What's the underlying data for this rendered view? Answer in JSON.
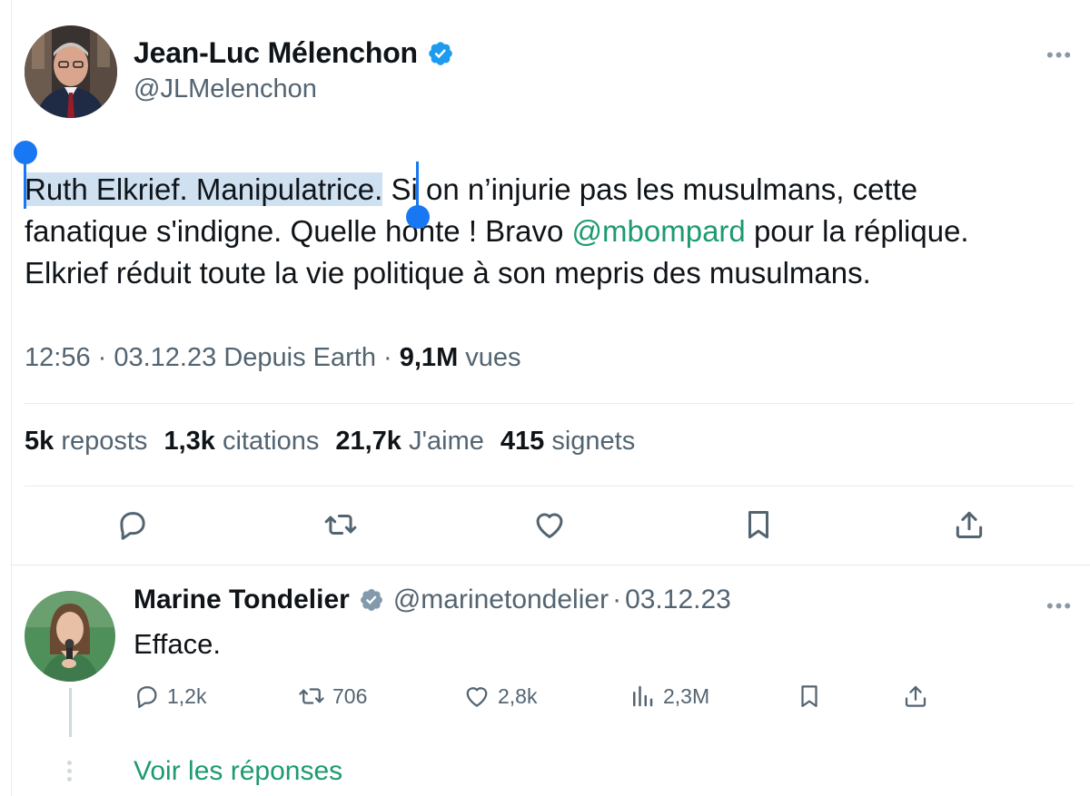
{
  "main_tweet": {
    "author_name": "Jean-Luc Mélenchon",
    "author_handle": "@JLMelenchon",
    "text_line1_selected": "Ruth Elkrief. Manipulatrice.",
    "text_line1_rest": " Si on n’injurie pas les musulmans, cette",
    "text_line2_before_mention": "fanatique s'indigne. Quelle honte ! Bravo ",
    "text_line2_mention": "@mbompard",
    "text_line2_after_mention": " pour la réplique.",
    "text_line3": "Elkrief réduit toute la vie politique à son mepris des musulmans.",
    "time": "12:56",
    "date": "03.12.23",
    "source": "Depuis Earth",
    "views_count": "9,1M",
    "views_label": "vues",
    "stats": [
      {
        "count": "5k",
        "label": "reposts"
      },
      {
        "count": "1,3k",
        "label": "citations"
      },
      {
        "count": "21,7k",
        "label": "J'aime"
      },
      {
        "count": "415",
        "label": "signets"
      }
    ],
    "actions": [
      "reply-icon",
      "repost-icon",
      "like-icon",
      "bookmark-icon",
      "share-icon"
    ]
  },
  "reply_tweet": {
    "author_name": "Marine Tondelier",
    "author_handle": "@marinetondelier",
    "separator": "·",
    "date": "03.12.23",
    "text": "Efface.",
    "replies": "1,2k",
    "reposts": "706",
    "likes": "2,8k",
    "views": "2,3M"
  },
  "show_replies_label": "Voir les réponses",
  "colors": {
    "accent": "#1d9b6e",
    "verified_blue": "#1d9bf0",
    "verified_gray": "#829aab",
    "selection": "#cfe0f1",
    "selection_handle": "#1877f2",
    "secondary_text": "#536471"
  }
}
